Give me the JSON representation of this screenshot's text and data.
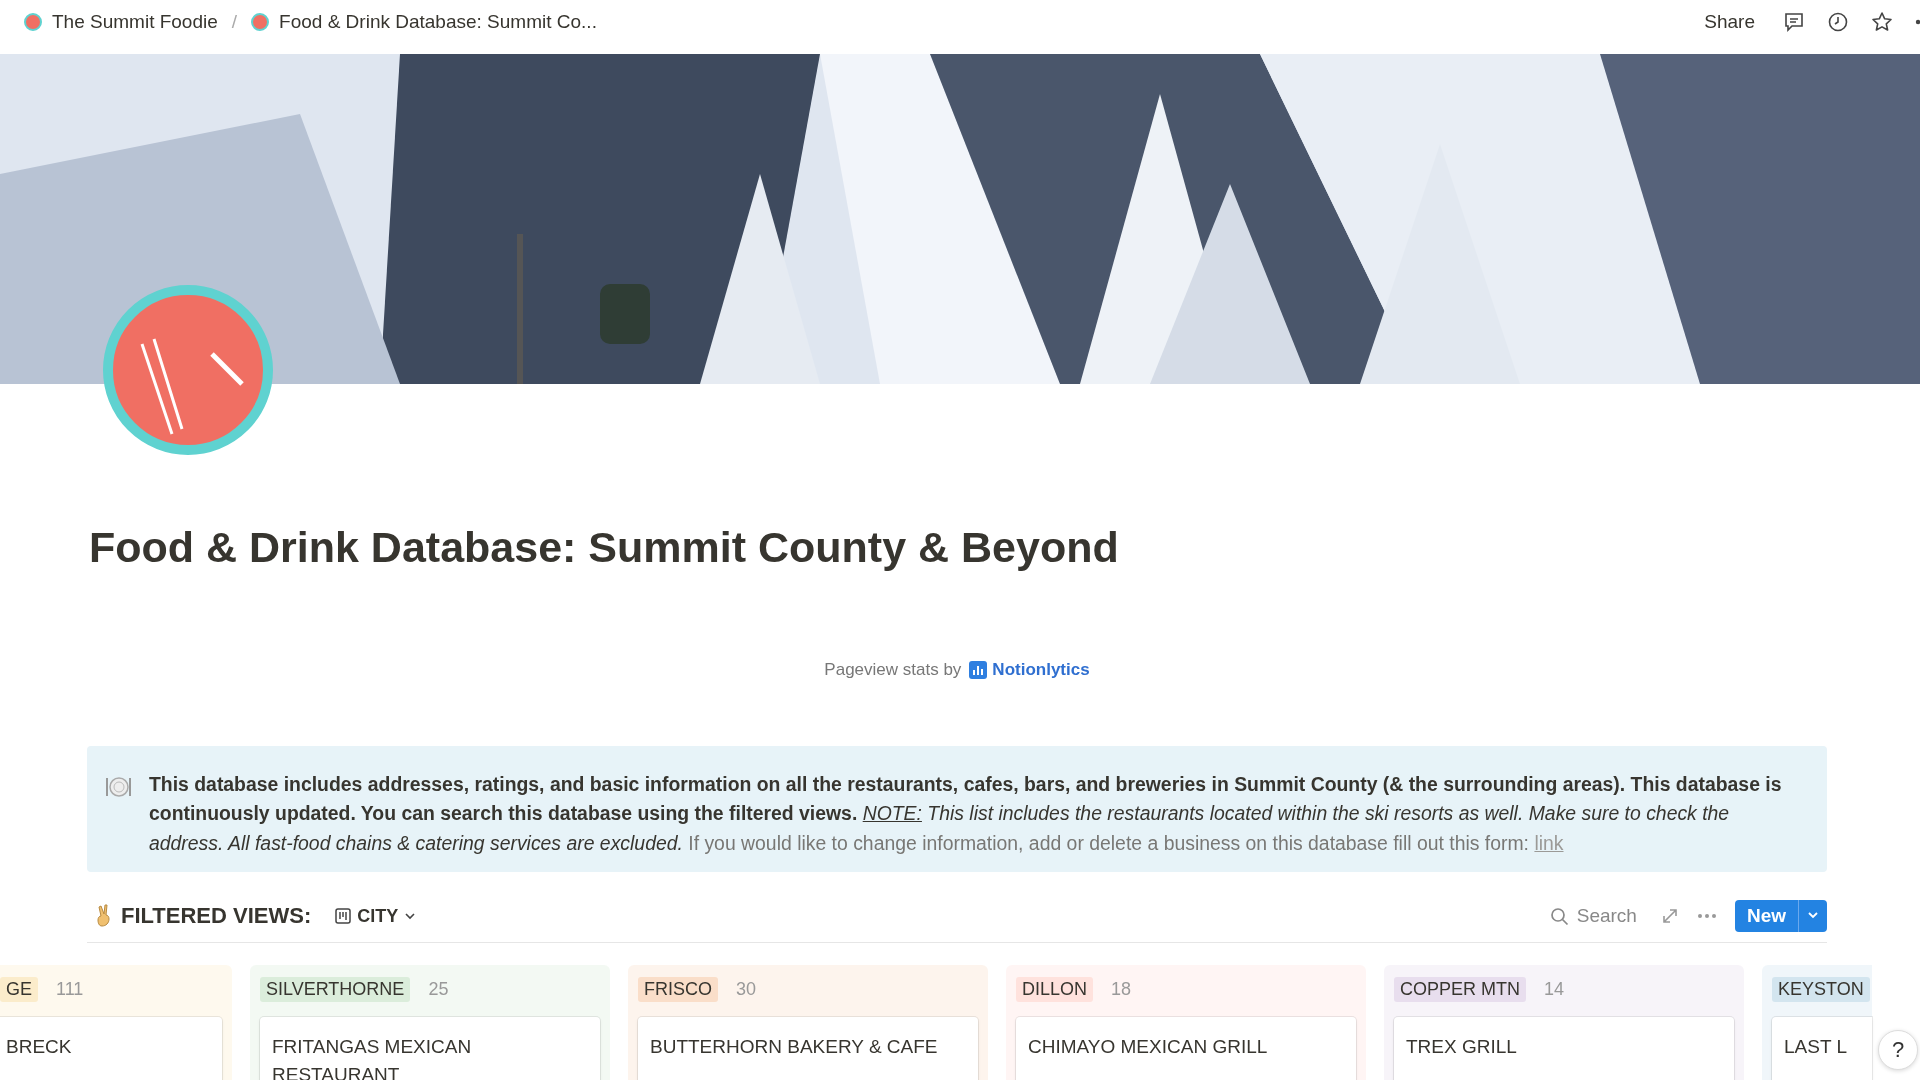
{
  "breadcrumb_separator": "/",
  "breadcrumbs": [
    {
      "label": "The Summit Foodie"
    },
    {
      "label": "Food & Drink Database: Summit Co..."
    }
  ],
  "topbar": {
    "share": "Share"
  },
  "title": "Food & Drink Database: Summit County & Beyond",
  "stats": {
    "text": "Pageview stats by",
    "link": "Notionlytics"
  },
  "callout": [
    {
      "kind": "bold",
      "text": "This database includes addresses, ratings, and basic information on all the restaurants, cafes, bars, and breweries in Summit County (& the surrounding areas). This database is continuously updated. You can search this database using the filtered views. "
    },
    {
      "kind": "note",
      "text": "NOTE:"
    },
    {
      "kind": "italic",
      "text": " This list includes the restaurants located within the ski resorts as well. Make sure to check the address. All fast-food chains & catering services are excluded."
    },
    {
      "kind": "muted",
      "text": " If you would like to change information, add or delete a business on this database fill out this form: "
    },
    {
      "kind": "link",
      "text": "link"
    }
  ],
  "views": {
    "heading": "FILTERED VIEWS:",
    "view": "CITY",
    "search": "Search",
    "new": "New"
  },
  "groups": [
    {
      "tag": "GE",
      "count": "111",
      "color": "#fbeccb",
      "kind": "cut_left",
      "cards": [
        "BRECK"
      ]
    },
    {
      "tag": "SILVERTHORNE",
      "count": "25",
      "color": "#dbeddb",
      "kind": "full",
      "cards": [
        "FRITANGAS MEXICAN RESTAURANT"
      ]
    },
    {
      "tag": "FRISCO",
      "count": "30",
      "color": "#fadec9",
      "kind": "full",
      "cards": [
        "BUTTERHORN BAKERY & CAFE"
      ]
    },
    {
      "tag": "DILLON",
      "count": "18",
      "color": "#ffe2dd",
      "kind": "full",
      "cards": [
        "CHIMAYO MEXICAN GRILL"
      ]
    },
    {
      "tag": "COPPER MTN",
      "count": "14",
      "color": "#e8deee",
      "kind": "full",
      "cards": [
        "TREX GRILL"
      ]
    },
    {
      "tag": "KEYSTON",
      "color": "#d3e5ef",
      "kind": "cut_right",
      "cards": [
        "LAST L"
      ]
    }
  ],
  "help": "?"
}
